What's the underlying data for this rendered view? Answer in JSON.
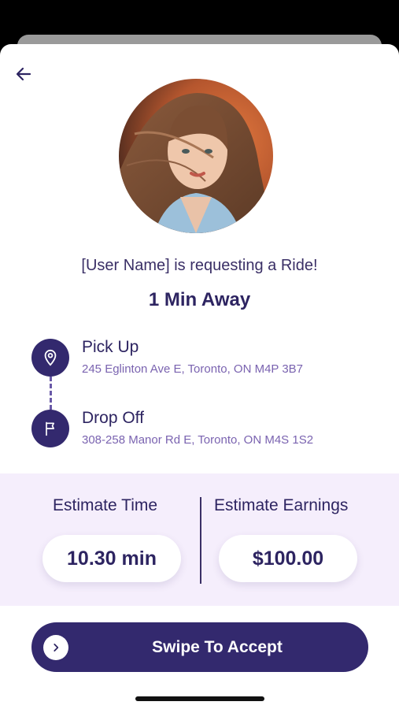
{
  "request": {
    "message": "[User Name] is requesting a Ride!",
    "eta": "1 Min Away"
  },
  "stops": {
    "pickup": {
      "title": "Pick Up",
      "address": "245 Eglinton Ave E, Toronto, ON M4P 3B7",
      "icon": "location-pin-icon"
    },
    "dropoff": {
      "title": "Drop Off",
      "address": "308-258 Manor Rd E, Toronto, ON M4S 1S2",
      "icon": "flag-icon"
    }
  },
  "estimates": {
    "time_label": "Estimate Time",
    "time_value": "10.30 min",
    "earnings_label": "Estimate Earnings",
    "earnings_value": "$100.00"
  },
  "action": {
    "swipe_label": "Swipe To Accept",
    "icon": "chevron-right-icon"
  },
  "colors": {
    "primary": "#33296e",
    "accent_text": "#7a63b0",
    "estimates_bg": "#f5eefc"
  }
}
